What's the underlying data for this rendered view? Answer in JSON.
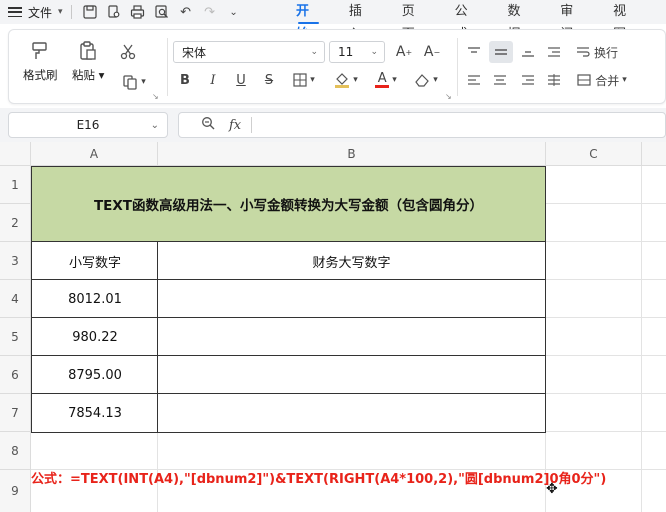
{
  "menubar": {
    "file_label": "文件",
    "tabs": [
      {
        "label": "开始",
        "active": true
      },
      {
        "label": "插入"
      },
      {
        "label": "页面"
      },
      {
        "label": "公式"
      },
      {
        "label": "数据"
      },
      {
        "label": "审阅"
      },
      {
        "label": "视图"
      }
    ]
  },
  "ribbon": {
    "format_painter": "格式刷",
    "paste": "粘贴",
    "font_name": "宋体",
    "font_size": "11",
    "wrap_text": "换行",
    "merge": "合并"
  },
  "formula_bar": {
    "cell_ref": "E16",
    "fx_label": "fx",
    "content": ""
  },
  "sheet": {
    "columns": [
      "A",
      "B",
      "C"
    ],
    "rows": [
      "1",
      "2",
      "3",
      "4",
      "5",
      "6",
      "7",
      "8",
      "9"
    ],
    "title": "TEXT函数高级用法一、小写金额转换为大写金额（包含圆角分）",
    "header_a": "小写数字",
    "header_b": "财务大写数字",
    "values": [
      "8012.01",
      "980.22",
      "8795.00",
      "7854.13"
    ],
    "formula_note": "公式：=TEXT(INT(A4),\"[dbnum2]\")&TEXT(RIGHT(A4*100,2),\"圆[dbnum2]0角0分\")"
  },
  "colors": {
    "accent": "#1a73e8",
    "title_fill": "#c6d9a4",
    "formula_text": "#e8231a"
  }
}
